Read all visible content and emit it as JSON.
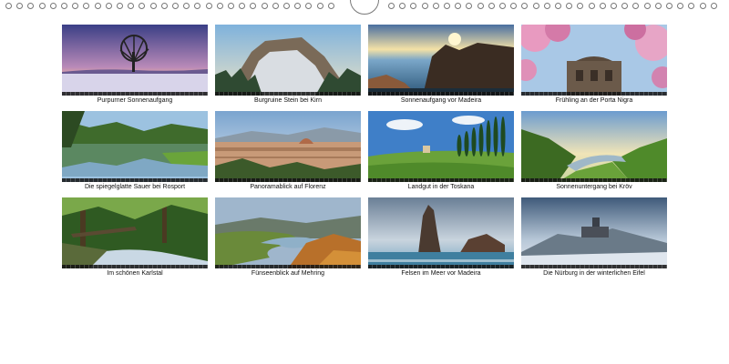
{
  "calendar": {
    "photos": [
      {
        "caption": "Purpurner Sonnenaufgang",
        "scene": "winter-tree-sunrise"
      },
      {
        "caption": "Burgruine Stein bei Kirn",
        "scene": "rock-castle-snow"
      },
      {
        "caption": "Sonnenaufgang vor Madeira",
        "scene": "coast-sunrise"
      },
      {
        "caption": "Frühling an der Porta Nigra",
        "scene": "blossoms-porta-nigra"
      },
      {
        "caption": "Die spiegelglatte Sauer bei Rosport",
        "scene": "river-reflection"
      },
      {
        "caption": "Panoramablick auf Florenz",
        "scene": "florence-panorama"
      },
      {
        "caption": "Landgut in der Toskana",
        "scene": "tuscany-cypresses"
      },
      {
        "caption": "Sonnenuntergang bei Kröv",
        "scene": "moselle-sunset"
      },
      {
        "caption": "Im schönen Karlstal",
        "scene": "forest-stream"
      },
      {
        "caption": "Fünseenblick auf Mehring",
        "scene": "autumn-river-bend"
      },
      {
        "caption": "Felsen im Meer vor Madeira",
        "scene": "sea-rocks"
      },
      {
        "caption": "Die Nürburg in der winterlichen Eifel",
        "scene": "winter-castle"
      }
    ]
  }
}
